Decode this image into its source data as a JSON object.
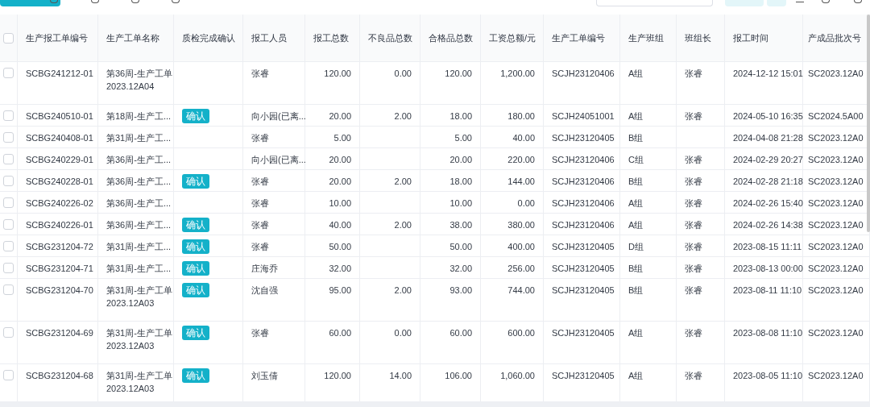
{
  "table": {
    "header_checkbox": {
      "checked": false
    },
    "columns": [
      "生产报工单编号",
      "生产工单名称",
      "质检完成确认",
      "报工人员",
      "报工总数",
      "不良品总数",
      "合格品总数",
      "工资总额/元",
      "生产工单编号",
      "生产班组",
      "班组长",
      "报工时间",
      "产成品批次号"
    ],
    "rows": [
      {
        "checked": false,
        "tall": true,
        "cells": [
          "SCBG241212-01",
          "第36周-生产工单\n2023.12A04",
          null,
          "张睿",
          "120.00",
          "0.00",
          "120.00",
          "1,200.00",
          "SCJH23120406",
          "A组",
          "张睿",
          "2024-12-12 15:01",
          "SC2023.12A0"
        ]
      },
      {
        "checked": false,
        "tall": false,
        "cells": [
          "SCBG240510-01",
          "第18周-生产工...",
          "确认",
          "向小园(已离...",
          "20.00",
          "2.00",
          "18.00",
          "180.00",
          "SCJH24051001",
          "A组",
          "张睿",
          "2024-05-10 16:35",
          "SC2024.5A00"
        ]
      },
      {
        "checked": false,
        "tall": false,
        "cells": [
          "SCBG240408-01",
          "第31周-生产工...",
          null,
          "张睿",
          "5.00",
          null,
          "5.00",
          "40.00",
          "SCJH23120405",
          "B组",
          null,
          "2024-04-08 21:28",
          "SC2023.12A0"
        ]
      },
      {
        "checked": false,
        "tall": false,
        "cells": [
          "SCBG240229-01",
          "第36周-生产工...",
          null,
          "向小园(已离...",
          "20.00",
          null,
          "20.00",
          "220.00",
          "SCJH23120406",
          "C组",
          "张睿",
          "2024-02-29 20:27",
          "SC2023.12A0"
        ]
      },
      {
        "checked": false,
        "tall": false,
        "cells": [
          "SCBG240228-01",
          "第36周-生产工...",
          "确认",
          "张睿",
          "20.00",
          "2.00",
          "18.00",
          "144.00",
          "SCJH23120406",
          "B组",
          "张睿",
          "2024-02-28 21:18",
          "SC2023.12A0"
        ]
      },
      {
        "checked": false,
        "tall": false,
        "cells": [
          "SCBG240226-02",
          "第36周-生产工...",
          null,
          "张睿",
          "10.00",
          null,
          "10.00",
          "0.00",
          "SCJH23120406",
          "A组",
          "张睿",
          "2024-02-26 15:40",
          "SC2023.12A0"
        ]
      },
      {
        "checked": false,
        "tall": false,
        "cells": [
          "SCBG240226-01",
          "第36周-生产工...",
          "确认",
          "张睿",
          "40.00",
          "2.00",
          "38.00",
          "380.00",
          "SCJH23120406",
          "A组",
          "张睿",
          "2024-02-26 14:38",
          "SC2023.12A0"
        ]
      },
      {
        "checked": false,
        "tall": false,
        "cells": [
          "SCBG231204-72",
          "第31周-生产工...",
          "确认",
          "张睿",
          "50.00",
          null,
          "50.00",
          "400.00",
          "SCJH23120405",
          "D组",
          "张睿",
          "2023-08-15 11:11",
          "SC2023.12A0"
        ]
      },
      {
        "checked": false,
        "tall": false,
        "cells": [
          "SCBG231204-71",
          "第31周-生产工...",
          "确认",
          "庄海乔",
          "32.00",
          null,
          "32.00",
          "256.00",
          "SCJH23120405",
          "B组",
          "张睿",
          "2023-08-13 00:00",
          "SC2023.12A0"
        ]
      },
      {
        "checked": false,
        "tall": true,
        "cells": [
          "SCBG231204-70",
          "第31周-生产工单\n2023.12A03",
          "确认",
          "沈自强",
          "95.00",
          "2.00",
          "93.00",
          "744.00",
          "SCJH23120405",
          "B组",
          "张睿",
          "2023-08-11 11:10",
          "SC2023.12A0"
        ]
      },
      {
        "checked": false,
        "tall": true,
        "cells": [
          "SCBG231204-69",
          "第31周-生产工单\n2023.12A03",
          "确认",
          "张睿",
          "60.00",
          "0.00",
          "60.00",
          "600.00",
          "SCJH23120405",
          "A组",
          "张睿",
          "2023-08-08 11:10",
          "SC2023.12A0"
        ]
      },
      {
        "checked": false,
        "tall": true,
        "cells": [
          "SCBG231204-68",
          "第31周-生产工单\n2023.12A03",
          "确认",
          "刘玉倩",
          "120.00",
          "14.00",
          "106.00",
          "1,060.00",
          "SCJH23120405",
          "A组",
          "张睿",
          "2023-08-05 11:10",
          "SC2023.12A0"
        ]
      }
    ]
  }
}
